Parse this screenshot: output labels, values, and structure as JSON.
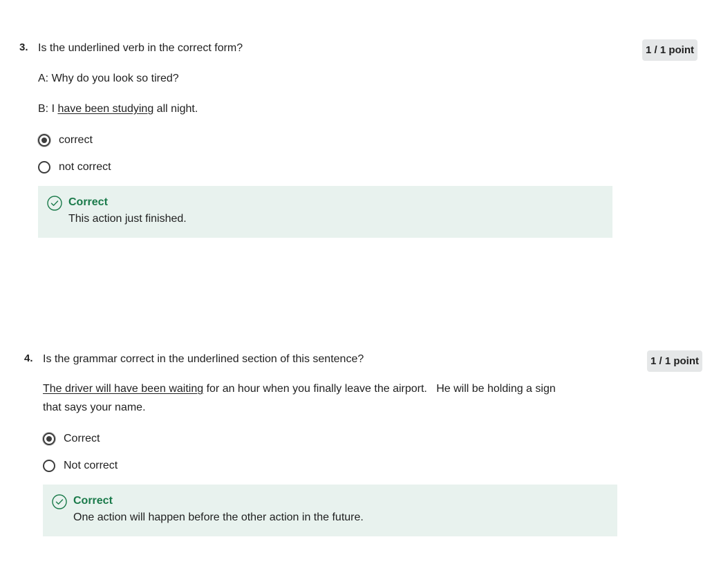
{
  "questions": [
    {
      "number": "3.",
      "prompt": "Is the underlined verb in the correct form?",
      "line_a": "A: Why do you look so tired?",
      "line_b_prefix": "B: I ",
      "line_b_underlined": "have been studying",
      "line_b_suffix": " all night.",
      "options": [
        {
          "label": "correct",
          "selected": true
        },
        {
          "label": "not correct",
          "selected": false
        }
      ],
      "feedback": {
        "title": "Correct",
        "text": "This action just finished."
      },
      "points": "1 / 1 point"
    },
    {
      "number": "4.",
      "prompt": "Is the grammar correct in the underlined section of this sentence?",
      "sentence_underlined": "The driver will have been waiting",
      "sentence_rest": " for an hour when you finally leave the airport.   He will be holding a sign that says your name.",
      "options": [
        {
          "label": "Correct",
          "selected": true
        },
        {
          "label": "Not correct",
          "selected": false
        }
      ],
      "feedback": {
        "title": "Correct",
        "text": "One action will happen before the other action in the future."
      },
      "points": "1 / 1 point"
    }
  ],
  "colors": {
    "feedback_bg": "#e8f2ee",
    "feedback_title": "#1a7a4a",
    "points_bg": "#e5e7e8"
  },
  "icons": {
    "feedback": "check-circle-icon"
  }
}
